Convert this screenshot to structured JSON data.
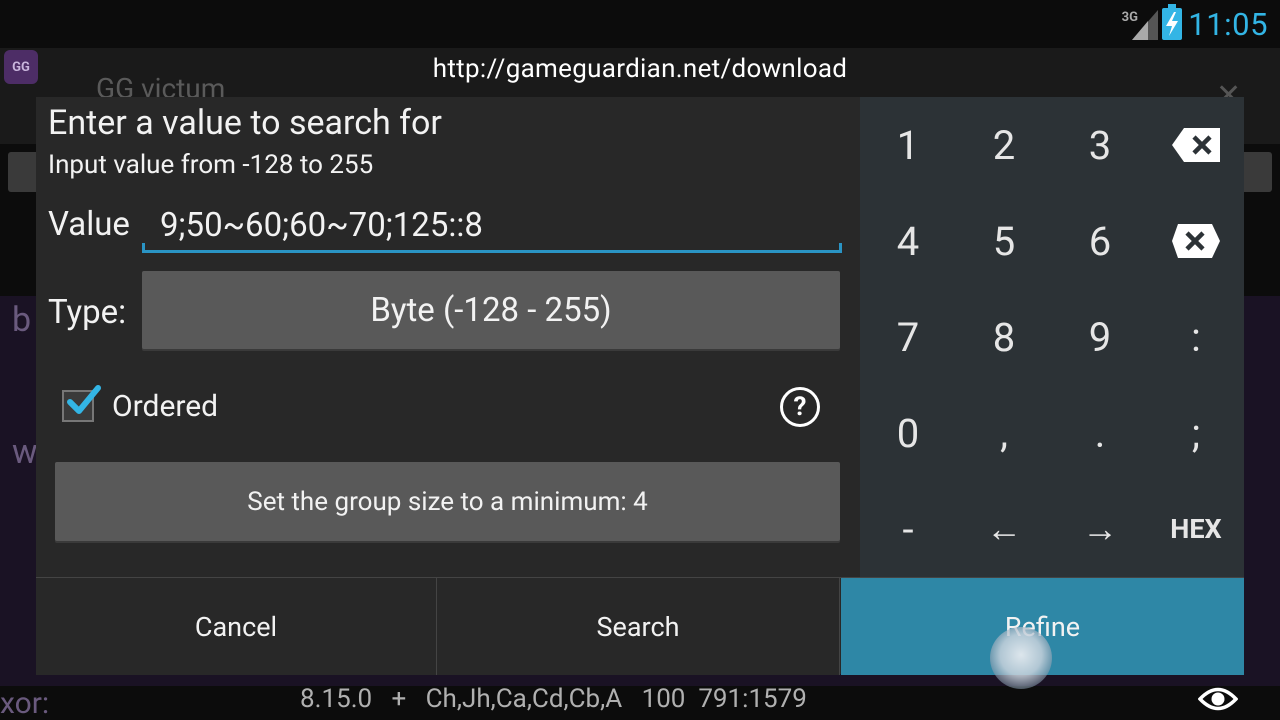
{
  "status_bar": {
    "network": "3G",
    "time": "11:05"
  },
  "background": {
    "app_logo": "GG",
    "app_title": "GG victum",
    "list_text_1": "b",
    "list_text_2": "w",
    "list_text_3": "xor:"
  },
  "url": "http://gameguardian.net/download",
  "dialog": {
    "title": "Enter a value to search for",
    "subtitle": "Input value from -128 to 255",
    "value_label": "Value",
    "value": "9;50~60;60~70;125::8",
    "type_label": "Type:",
    "type_value": "Byte (-128 - 255)",
    "ordered_label": "Ordered",
    "ordered_checked": true,
    "group_button": "Set the group size to a minimum: 4",
    "keypad": [
      [
        "1",
        "2",
        "3",
        "backspace"
      ],
      [
        "4",
        "5",
        "6",
        "clear"
      ],
      [
        "7",
        "8",
        "9",
        ":"
      ],
      [
        "0",
        ",",
        ".",
        ";"
      ],
      [
        "-",
        "←",
        "→",
        "HEX"
      ]
    ],
    "buttons": {
      "cancel": "Cancel",
      "search": "Search",
      "refine": "Refine"
    }
  },
  "bottom_info": "8.15.0   +   Ch,Jh,Ca,Cd,Cb,A   100  791:1579",
  "colors": {
    "accent": "#33b5e5",
    "input_underline": "#2a94c4",
    "refine_button": "#2e87a6",
    "keypad_bg": "#2c3236"
  }
}
